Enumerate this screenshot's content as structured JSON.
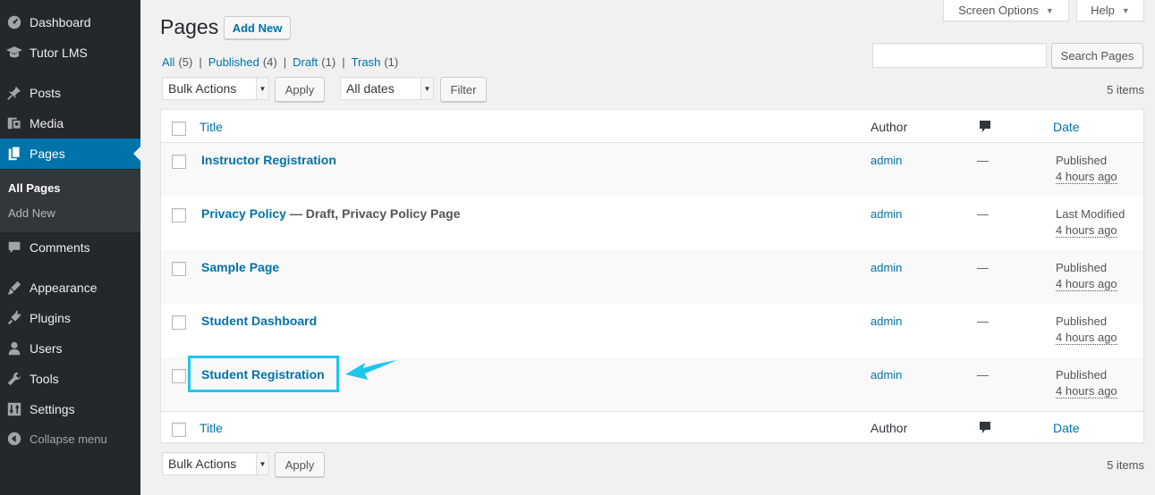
{
  "sidebar": {
    "items": [
      {
        "label": "Dashboard",
        "icon": "dashboard-icon"
      },
      {
        "label": "Tutor LMS",
        "icon": "graduation-cap-icon"
      },
      {
        "label": "Posts",
        "icon": "pin-icon"
      },
      {
        "label": "Media",
        "icon": "media-icon"
      },
      {
        "label": "Pages",
        "icon": "pages-icon"
      },
      {
        "label": "Comments",
        "icon": "comment-icon"
      },
      {
        "label": "Appearance",
        "icon": "brush-icon"
      },
      {
        "label": "Plugins",
        "icon": "plug-icon"
      },
      {
        "label": "Users",
        "icon": "user-icon"
      },
      {
        "label": "Tools",
        "icon": "wrench-icon"
      },
      {
        "label": "Settings",
        "icon": "settings-icon"
      },
      {
        "label": "Collapse menu",
        "icon": "collapse-icon"
      }
    ],
    "submenu": [
      {
        "label": "All Pages"
      },
      {
        "label": "Add New"
      }
    ]
  },
  "header": {
    "title": "Pages",
    "add_new": "Add New",
    "screen_options": "Screen Options",
    "help": "Help"
  },
  "filters": {
    "views": [
      {
        "label": "All",
        "count": "(5)"
      },
      {
        "label": "Published",
        "count": "(4)"
      },
      {
        "label": "Draft",
        "count": "(1)"
      },
      {
        "label": "Trash",
        "count": "(1)"
      }
    ],
    "separator": "|",
    "bulk_actions": "Bulk Actions",
    "apply": "Apply",
    "all_dates": "All dates",
    "filter": "Filter",
    "search_button": "Search Pages",
    "search_placeholder": "",
    "items_count": "5 items"
  },
  "table": {
    "headers": {
      "title": "Title",
      "author": "Author",
      "date": "Date"
    },
    "rows": [
      {
        "title": "Instructor Registration",
        "state": "",
        "author": "admin",
        "comments": "—",
        "status": "Published",
        "ago": "4 hours ago"
      },
      {
        "title": "Privacy Policy",
        "state": " — Draft, Privacy Policy Page",
        "author": "admin",
        "comments": "—",
        "status": "Last Modified",
        "ago": "4 hours ago"
      },
      {
        "title": "Sample Page",
        "state": "",
        "author": "admin",
        "comments": "—",
        "status": "Published",
        "ago": "4 hours ago"
      },
      {
        "title": "Student Dashboard",
        "state": "",
        "author": "admin",
        "comments": "—",
        "status": "Published",
        "ago": "4 hours ago"
      },
      {
        "title": "Student Registration",
        "state": "",
        "author": "admin",
        "comments": "—",
        "status": "Published",
        "ago": "4 hours ago"
      }
    ]
  },
  "colors": {
    "sidebar_bg": "#23282d",
    "accent": "#0073aa",
    "highlight": "#1fc6ee"
  }
}
